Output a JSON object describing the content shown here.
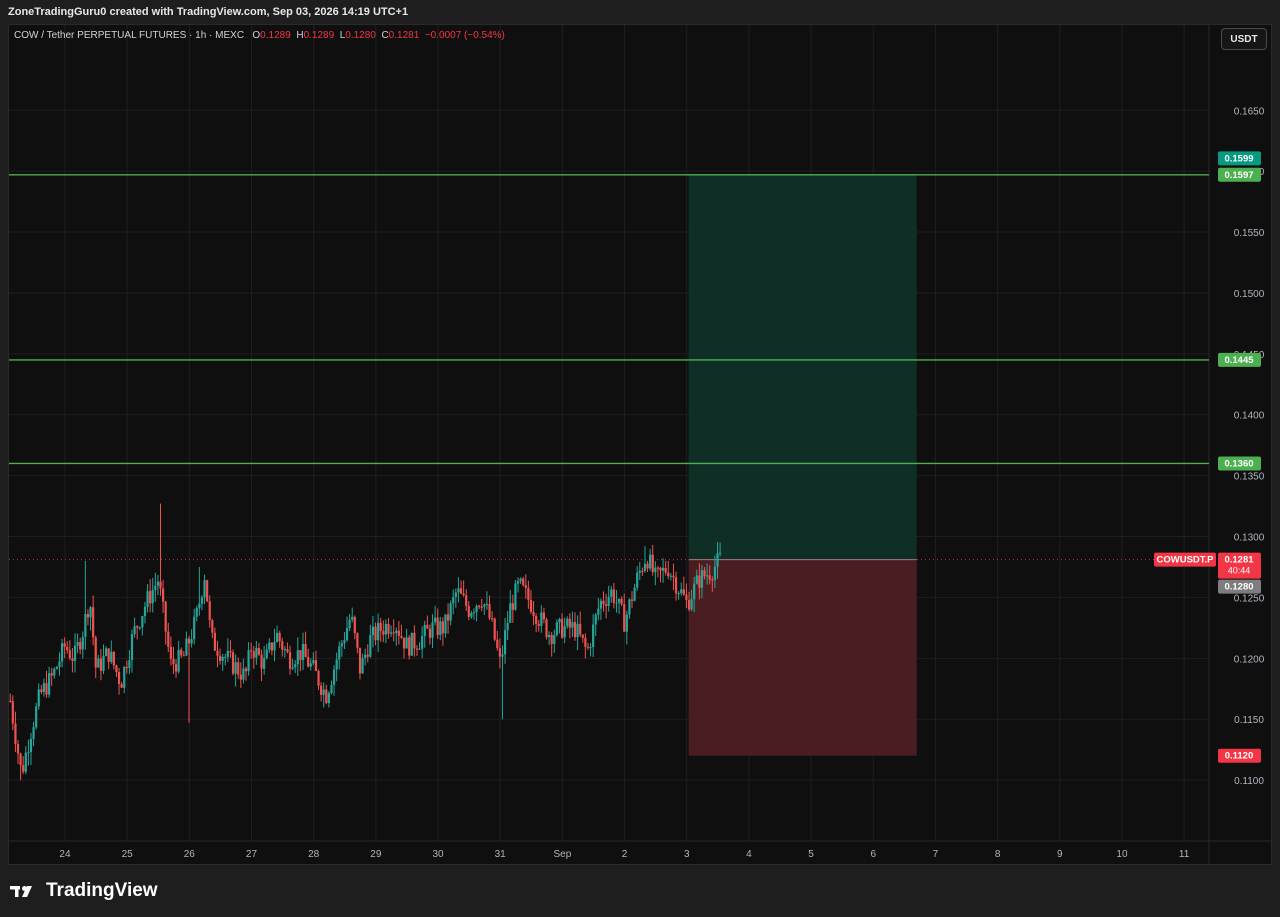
{
  "header": {
    "attribution": "ZoneTradingGuru0 created with TradingView.com, Sep 03, 2026 14:19 UTC+1"
  },
  "legend": {
    "symbol": "COW / Tether PERPETUAL FUTURES · 1h · MEXC",
    "o_label": "O",
    "o_value": "0.1289",
    "h_label": "H",
    "h_value": "0.1289",
    "l_label": "L",
    "l_value": "0.1280",
    "c_label": "C",
    "c_value": "0.1281",
    "change": "−0.0007 (−0.54%)"
  },
  "currency_button": "USDT",
  "brand": {
    "name": "TradingView",
    "icon": "tradingview-logo-icon"
  },
  "colors": {
    "up": "#26a69a",
    "down": "#ef5350",
    "level_line": "#4caf50",
    "profit_zone": "#0e2e26",
    "loss_zone": "#4a1d20",
    "price_label_red": "#f23645",
    "price_label_green": "#089981"
  },
  "chart_data": {
    "type": "candlestick",
    "timeframe": "1h",
    "ylim": [
      0.105,
      0.172
    ],
    "y_ticks": [
      "0.1100",
      "0.1150",
      "0.1200",
      "0.1250",
      "0.1300",
      "0.1350",
      "0.1400",
      "0.1450",
      "0.1500",
      "0.1550",
      "0.1600",
      "0.1650"
    ],
    "x_ticks": [
      "24",
      "25",
      "26",
      "27",
      "28",
      "29",
      "30",
      "31",
      "Sep",
      "2",
      "3",
      "4",
      "5",
      "6",
      "7",
      "8",
      "9",
      "10",
      "11"
    ],
    "x_tick_positions_days": [
      24,
      25,
      26,
      27,
      28,
      29,
      30,
      31,
      32,
      33,
      34,
      35,
      36,
      37,
      38,
      39,
      40,
      41,
      42
    ],
    "x_range_days": [
      23.1,
      42.4
    ],
    "horizontal_levels": [
      0.1597,
      0.1445,
      0.136
    ],
    "position": {
      "type": "long",
      "entry": 0.1281,
      "target": 0.1597,
      "stop": 0.112,
      "start_day": 34.03,
      "end_day": 37.7
    },
    "price_labels": [
      {
        "value": "0.1599",
        "kind": "target-top",
        "color": "#089981"
      },
      {
        "value": "0.1597",
        "kind": "level",
        "color": "#4caf50"
      },
      {
        "value": "0.1445",
        "kind": "level",
        "color": "#4caf50"
      },
      {
        "value": "0.1360",
        "kind": "level",
        "color": "#4caf50"
      },
      {
        "value": "0.1281",
        "kind": "last-price",
        "color": "#f23645",
        "countdown": "40:44",
        "symbol_tag": "COWUSDT.P"
      },
      {
        "value": "0.1280",
        "kind": "bid",
        "color": "#7d7d7d"
      },
      {
        "value": "0.1120",
        "kind": "stop",
        "color": "#f23645"
      }
    ],
    "price_anchors": [
      [
        23.12,
        0.1165
      ],
      [
        23.3,
        0.1105
      ],
      [
        23.45,
        0.114
      ],
      [
        23.6,
        0.117
      ],
      [
        23.8,
        0.1185
      ],
      [
        24.0,
        0.121
      ],
      [
        24.15,
        0.12
      ],
      [
        24.3,
        0.1225
      ],
      [
        24.4,
        0.125
      ],
      [
        24.5,
        0.119
      ],
      [
        24.7,
        0.1205
      ],
      [
        24.9,
        0.118
      ],
      [
        25.1,
        0.122
      ],
      [
        25.3,
        0.1245
      ],
      [
        25.5,
        0.1265
      ],
      [
        25.7,
        0.1195
      ],
      [
        25.9,
        0.12
      ],
      [
        26.1,
        0.123
      ],
      [
        26.25,
        0.127
      ],
      [
        26.35,
        0.1215
      ],
      [
        26.6,
        0.12
      ],
      [
        26.9,
        0.1185
      ],
      [
        27.0,
        0.121
      ],
      [
        27.2,
        0.1195
      ],
      [
        27.4,
        0.122
      ],
      [
        27.6,
        0.12
      ],
      [
        27.8,
        0.1205
      ],
      [
        28.0,
        0.119
      ],
      [
        28.2,
        0.117
      ],
      [
        28.4,
        0.1205
      ],
      [
        28.6,
        0.1235
      ],
      [
        28.75,
        0.119
      ],
      [
        28.9,
        0.1215
      ],
      [
        29.1,
        0.1225
      ],
      [
        29.3,
        0.123
      ],
      [
        29.5,
        0.121
      ],
      [
        29.7,
        0.1215
      ],
      [
        29.9,
        0.1225
      ],
      [
        30.1,
        0.1225
      ],
      [
        30.3,
        0.1255
      ],
      [
        30.5,
        0.124
      ],
      [
        30.7,
        0.125
      ],
      [
        30.85,
        0.123
      ],
      [
        31.0,
        0.1195
      ],
      [
        31.15,
        0.124
      ],
      [
        31.3,
        0.126
      ],
      [
        31.5,
        0.1245
      ],
      [
        31.6,
        0.1235
      ],
      [
        31.8,
        0.122
      ],
      [
        32.0,
        0.1225
      ],
      [
        32.2,
        0.1225
      ],
      [
        32.4,
        0.1205
      ],
      [
        32.6,
        0.1245
      ],
      [
        32.8,
        0.1255
      ],
      [
        33.0,
        0.123
      ],
      [
        33.2,
        0.1265
      ],
      [
        33.35,
        0.1285
      ],
      [
        33.5,
        0.1265
      ],
      [
        33.7,
        0.1275
      ],
      [
        33.9,
        0.1255
      ],
      [
        34.0,
        0.1245
      ],
      [
        34.2,
        0.1265
      ],
      [
        34.4,
        0.1272
      ],
      [
        34.55,
        0.1282
      ]
    ],
    "wick_spikes": [
      {
        "day": 25.52,
        "high": 0.1327
      },
      {
        "day": 24.32,
        "high": 0.128
      },
      {
        "day": 26.15,
        "high": 0.1275
      },
      {
        "day": 33.32,
        "high": 0.1292
      },
      {
        "day": 34.55,
        "high": 0.1294
      },
      {
        "day": 31.02,
        "low": 0.115
      },
      {
        "day": 26.0,
        "low": 0.1147
      },
      {
        "day": 23.3,
        "low": 0.11
      }
    ]
  }
}
